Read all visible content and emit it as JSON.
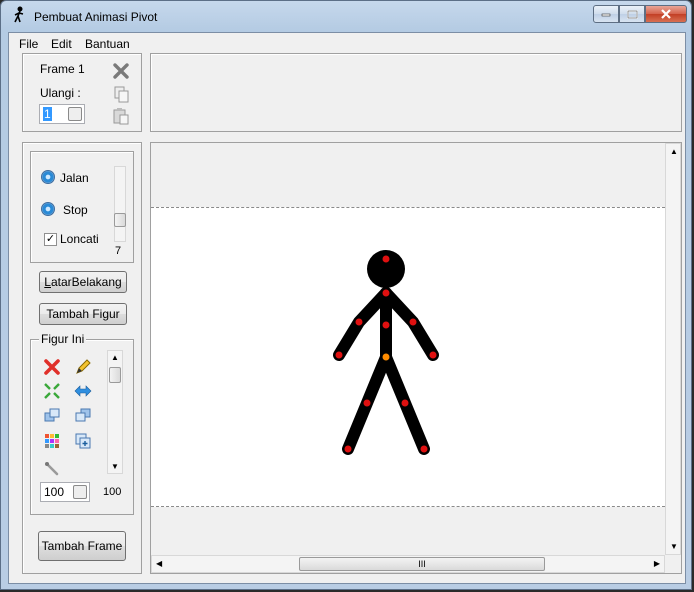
{
  "window": {
    "title": "Pembuat Animasi Pivot"
  },
  "menu": [
    "File",
    "Edit",
    "Bantuan"
  ],
  "frame_panel": {
    "frame_label": "Frame 1",
    "repeat_label": "Ulangi :",
    "repeat_value": "1"
  },
  "playback": {
    "play_label": "Jalan",
    "stop_label": "Stop",
    "loop_label": "Loncati",
    "loop_checked": true,
    "speed_value": "7"
  },
  "buttons": {
    "background": "LatarBelakang",
    "add_figure": "Tambah Figur",
    "add_frame": "Tambah Frame"
  },
  "figure_panel": {
    "title": "Figur Ini",
    "scale_value": "100",
    "scale_readout": "100"
  },
  "scrollbar": {
    "grip": "III"
  },
  "icons": {
    "close": "close-icon",
    "copy": "copy-icon",
    "paste": "paste-icon",
    "delete": "delete-icon",
    "edit": "pencil-icon"
  }
}
